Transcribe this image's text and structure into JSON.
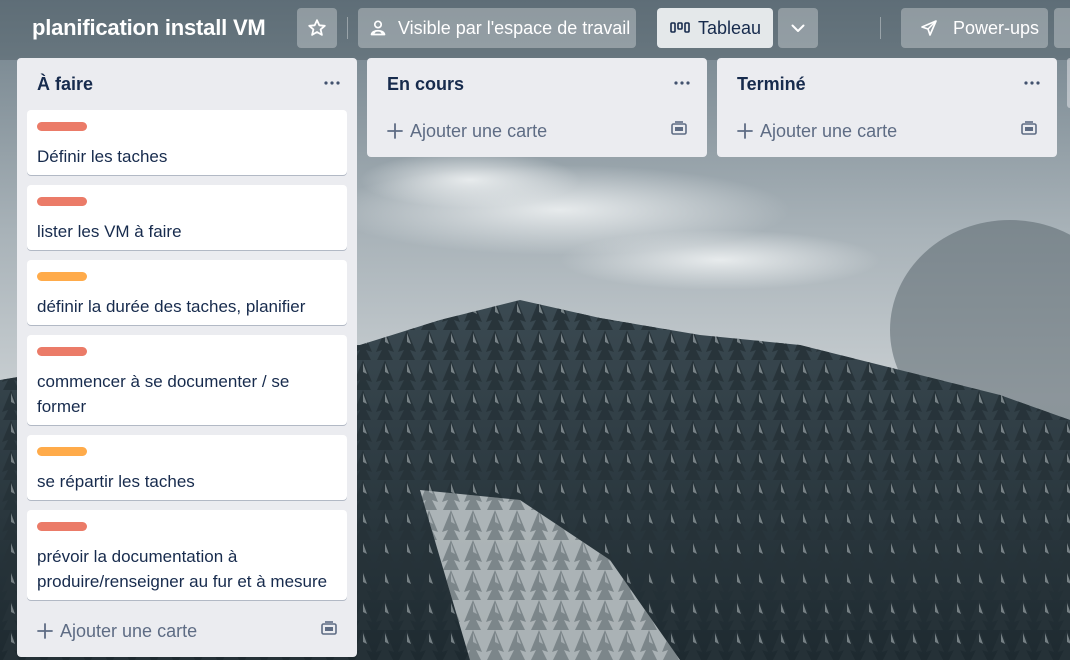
{
  "board": {
    "title": "planification install VM"
  },
  "header": {
    "star_icon": "star-icon",
    "visibility_label": "Visible par l'espace de travail",
    "visibility_icon": "team-icon",
    "view_label": "Tableau",
    "view_icon": "board-view-icon",
    "view_dropdown_icon": "chevron-down-icon",
    "powerups_label": "Power-ups",
    "powerups_icon": "rocket-icon"
  },
  "lists": [
    {
      "title": "À faire",
      "menu_icon": "ellipsis-icon",
      "cards": [
        {
          "label_color": "red",
          "text": "Définir les taches"
        },
        {
          "label_color": "red",
          "text": "lister les VM à faire"
        },
        {
          "label_color": "orange",
          "text": "définir la durée des taches, planifier"
        },
        {
          "label_color": "red",
          "text": "commencer à se documenter / se former"
        },
        {
          "label_color": "orange",
          "text": "se répartir les taches"
        },
        {
          "label_color": "red",
          "text": "prévoir la documentation à produire/renseigner au fur et à mesure"
        }
      ],
      "add_card_label": "Ajouter une carte",
      "template_icon": "card-template-icon"
    },
    {
      "title": "En cours",
      "menu_icon": "ellipsis-icon",
      "cards": [],
      "add_card_label": "Ajouter une carte",
      "template_icon": "card-template-icon"
    },
    {
      "title": "Terminé",
      "menu_icon": "ellipsis-icon",
      "cards": [],
      "add_card_label": "Ajouter une carte",
      "template_icon": "card-template-icon"
    }
  ],
  "colors": {
    "label_red": "#eb7b68",
    "label_orange": "#ffab4a",
    "list_bg": "#ebecf0",
    "text_dark": "#172b4d",
    "text_muted": "#5e6c84"
  }
}
